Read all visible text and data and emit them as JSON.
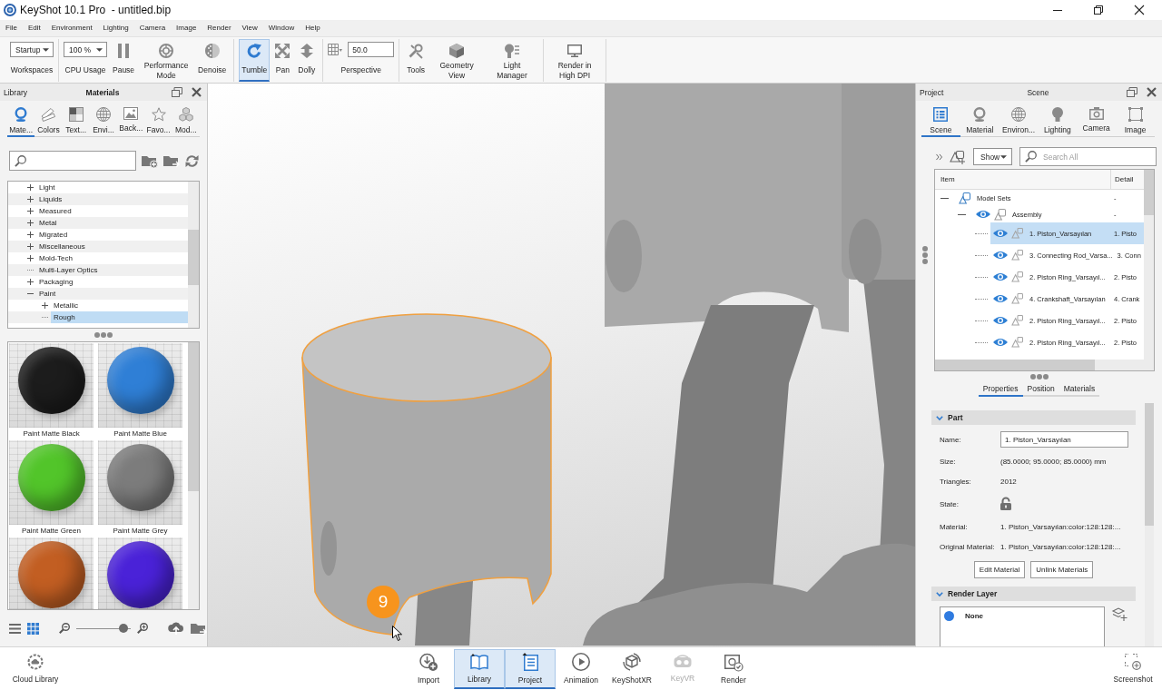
{
  "window": {
    "title": "KeyShot 10.1 Pro  - untitled.bip"
  },
  "menu": [
    "File",
    "Edit",
    "Environment",
    "Lighting",
    "Camera",
    "Image",
    "Render",
    "View",
    "Window",
    "Help"
  ],
  "toolbar": [
    [
      {
        "kind": "dropdown",
        "value": "Startup",
        "label": "Workspaces"
      }
    ],
    [
      {
        "kind": "dropdown",
        "value": "100 %",
        "label": "CPU Usage"
      },
      {
        "kind": "button",
        "label": "Pause"
      },
      {
        "kind": "button",
        "label": "Performance Mode"
      },
      {
        "kind": "button",
        "label": "Denoise"
      }
    ],
    [
      {
        "kind": "toggle",
        "label": "Tumble",
        "selected": true
      },
      {
        "kind": "toggle",
        "label": "Pan",
        "selected": false
      },
      {
        "kind": "toggle",
        "label": "Dolly",
        "selected": false
      }
    ],
    [
      {
        "kind": "field",
        "value": "50.0",
        "label": "Perspective"
      }
    ],
    [
      {
        "kind": "button",
        "label": "Tools"
      },
      {
        "kind": "button",
        "label": "Geometry View"
      },
      {
        "kind": "button",
        "label": "Light Manager"
      }
    ],
    [
      {
        "kind": "button",
        "label": "Render in High DPI"
      }
    ]
  ],
  "library": {
    "title": "Library",
    "heading": "Materials",
    "tabs": [
      {
        "label": "Mate...",
        "selected": true
      },
      {
        "label": "Colors",
        "selected": false
      },
      {
        "label": "Text...",
        "selected": false
      },
      {
        "label": "Envi...",
        "selected": false
      },
      {
        "label": "Back...",
        "selected": false
      },
      {
        "label": "Favo...",
        "selected": false
      },
      {
        "label": "Mod...",
        "selected": false
      }
    ],
    "tree": [
      {
        "label": "Light",
        "kind": "folder",
        "expanded": false,
        "selected": false
      },
      {
        "label": "Liquids",
        "kind": "folder",
        "expanded": false,
        "selected": false
      },
      {
        "label": "Measured",
        "kind": "folder",
        "expanded": false,
        "selected": false
      },
      {
        "label": "Metal",
        "kind": "folder",
        "expanded": false,
        "selected": false
      },
      {
        "label": "Migrated",
        "kind": "folder",
        "expanded": false,
        "selected": false
      },
      {
        "label": "Miscellaneous",
        "kind": "folder",
        "expanded": false,
        "selected": false
      },
      {
        "label": "Mold-Tech",
        "kind": "folder",
        "expanded": false,
        "selected": false
      },
      {
        "label": "Multi-Layer Optics",
        "kind": "leaf",
        "selected": false
      },
      {
        "label": "Packaging",
        "kind": "folder",
        "expanded": false,
        "selected": false
      },
      {
        "label": "Paint",
        "kind": "folder",
        "expanded": true,
        "selected": false,
        "children": [
          {
            "label": "Metallic",
            "kind": "folder",
            "expanded": false,
            "selected": false
          },
          {
            "label": "Rough",
            "kind": "leaf",
            "selected": true
          }
        ]
      }
    ],
    "thumbnails": [
      {
        "name": "Paint Matte Black",
        "color": "#1c1c1c"
      },
      {
        "name": "Paint Matte Blue",
        "color": "#2f7fd6"
      },
      {
        "name": "Paint Matte Green",
        "color": "#52c52a"
      },
      {
        "name": "Paint Matte Grey",
        "color": "#7c7c7c"
      },
      {
        "color": "#c25e22"
      },
      {
        "color": "#4a22d8"
      }
    ],
    "view_modes": [
      {
        "selected": false
      },
      {
        "selected": true
      }
    ],
    "thumbnail_size": {
      "level": 0.86
    }
  },
  "viewport": {
    "step_badge": "9"
  },
  "project": {
    "title": "Project",
    "heading": "Scene",
    "tabs": [
      {
        "label": "Scene",
        "selected": true
      },
      {
        "label": "Material",
        "selected": false
      },
      {
        "label": "Environ...",
        "selected": false
      },
      {
        "label": "Lighting",
        "selected": false
      },
      {
        "label": "Camera",
        "selected": false
      },
      {
        "label": "Image",
        "selected": false
      }
    ],
    "filter": "Show",
    "search": {
      "placeholder": "Search All"
    },
    "scene_tree": {
      "columns": [
        "Item",
        "Detail"
      ],
      "rows": [
        {
          "kind": "set",
          "label": "Model Sets",
          "detail": "-",
          "expanded": true,
          "selected": false,
          "children": [
            {
              "kind": "group",
              "label": "Assembly",
              "detail": "-",
              "expanded": true,
              "visible": true,
              "selected": false,
              "children": [
                {
                  "kind": "part",
                  "label": "1. Piston_Varsayılan",
                  "detail": "1. Pisto",
                  "visible": true,
                  "selected": true
                },
                {
                  "kind": "part",
                  "label": "3. Connecting Rod_Varsa...",
                  "detail": "3. Conn",
                  "visible": true,
                  "selected": false
                },
                {
                  "kind": "part",
                  "label": "2. Piston Ring_Varsayıl...",
                  "detail": "2. Pisto",
                  "visible": true,
                  "selected": false
                },
                {
                  "kind": "part",
                  "label": "4. Crankshaft_Varsayılan",
                  "detail": "4. Crank",
                  "visible": true,
                  "selected": false
                },
                {
                  "kind": "part",
                  "label": "2. Piston Ring_Varsayıl...",
                  "detail": "2. Pisto",
                  "visible": true,
                  "selected": false
                },
                {
                  "kind": "part",
                  "label": "2. Piston Ring_Varsayıl...",
                  "detail": "2. Pisto",
                  "visible": true,
                  "selected": false
                }
              ]
            }
          ]
        }
      ]
    },
    "property_tabs": [
      {
        "label": "Properties",
        "selected": true
      },
      {
        "label": "Position",
        "selected": false
      },
      {
        "label": "Materials",
        "selected": false
      }
    ],
    "part": {
      "title": "Part",
      "expanded": true,
      "fields": [
        {
          "kind": "input",
          "label": "Name:",
          "value": "1. Piston_Varsayılan"
        },
        {
          "kind": "text",
          "label": "Size:",
          "value": "(85.0000; 95.0000; 85.0000) mm"
        },
        {
          "kind": "text",
          "label": "Triangles:",
          "value": "2012"
        },
        {
          "kind": "lock",
          "label": "State:",
          "locked": false
        },
        {
          "kind": "text",
          "label": "Material:",
          "value": "1. Piston_Varsayılan:color:128:128:..."
        },
        {
          "kind": "text",
          "label": "Original Material:",
          "value": "1. Piston_Varsayılan:color:128:128:..."
        }
      ],
      "buttons": [
        "Edit Material",
        "Unlink Materials"
      ]
    },
    "render_layer": {
      "title": "Render Layer",
      "expanded": true,
      "layers": [
        {
          "name": "None",
          "color": "#2f7be0"
        }
      ]
    }
  },
  "dock": {
    "left": {
      "label": "Cloud Library"
    },
    "center": [
      {
        "label": "Import",
        "selected": false,
        "disabled": false
      },
      {
        "label": "Library",
        "selected": true,
        "disabled": false
      },
      {
        "label": "Project",
        "selected": true,
        "disabled": false
      },
      {
        "label": "Animation",
        "selected": false,
        "disabled": false
      },
      {
        "label": "KeyShotXR",
        "selected": false,
        "disabled": false
      },
      {
        "label": "KeyVR",
        "selected": false,
        "disabled": true
      },
      {
        "label": "Render",
        "selected": false,
        "disabled": false
      }
    ],
    "right": {
      "label": "Screenshot"
    }
  }
}
